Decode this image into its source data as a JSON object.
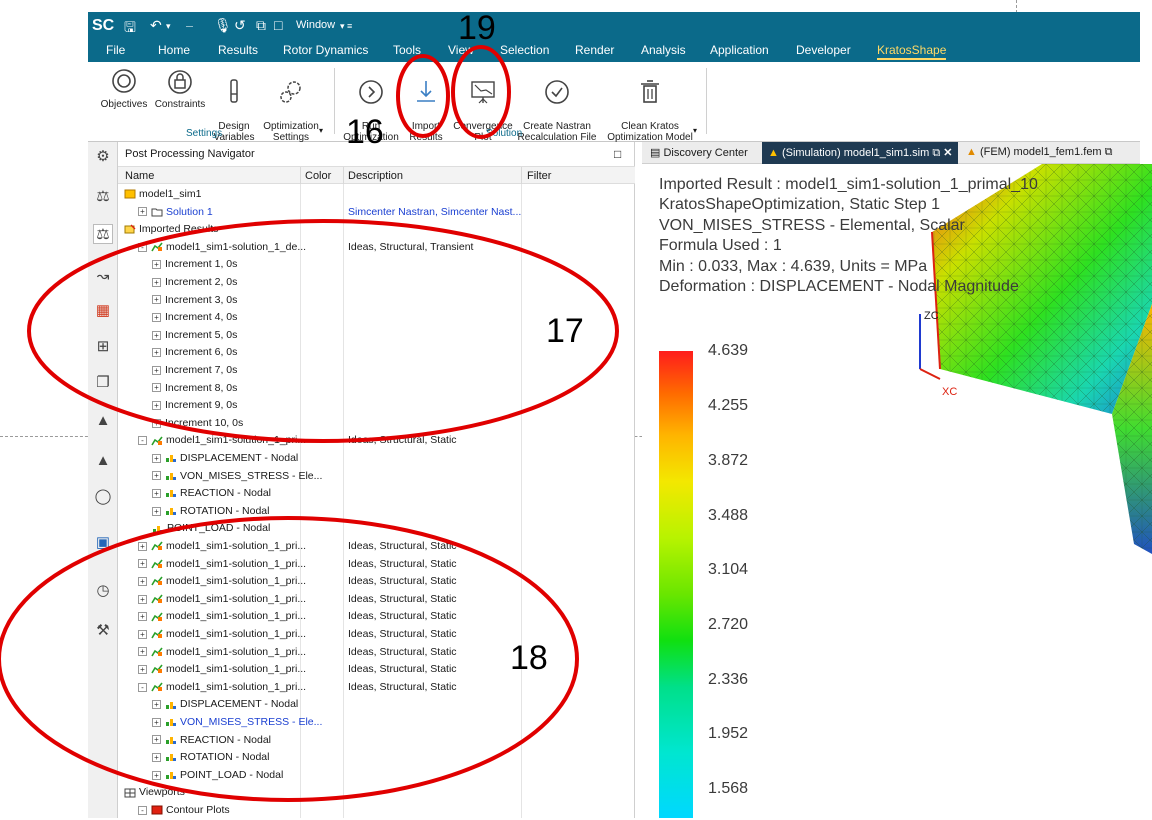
{
  "titlebar": {
    "logo": "SC",
    "window_label": "Window"
  },
  "menu": [
    "File",
    "Home",
    "Results",
    "Rotor Dynamics",
    "Tools",
    "View",
    "Selection",
    "Render",
    "Analysis",
    "Application",
    "Developer",
    "KratosShape"
  ],
  "ribbon": {
    "settings_buttons": [
      "Objectives",
      "Constraints",
      "Design\nVariables",
      "Optimization\nSettings"
    ],
    "settings_label": "Settings",
    "solution_buttons": [
      "Run\nOptimization",
      "Import\nResults",
      "Convergence\nPlot",
      "Create Nastran\nRecalculation File",
      "Clean Kratos\nOptimization Model"
    ],
    "solution_label": "Solution"
  },
  "navigator": {
    "title": "Post Processing Navigator",
    "columns": [
      "Name",
      "Color",
      "Description",
      "Filter"
    ],
    "rows": [
      {
        "name": "model1_sim1",
        "desc": "",
        "indent": 0,
        "exp": "",
        "icon": "sim"
      },
      {
        "name": "Solution 1",
        "desc": "Simcenter Nastran, Simcenter Nast...",
        "indent": 1,
        "exp": "+",
        "icon": "folder",
        "blue": true
      },
      {
        "name": "Imported Results",
        "desc": "",
        "indent": 0,
        "exp": "",
        "icon": "import"
      },
      {
        "name": "model1_sim1-solution_1_de...",
        "desc": "Ideas, Structural, Transient",
        "indent": 1,
        "exp": "-",
        "icon": "result"
      },
      {
        "name": "Increment 1, 0s",
        "desc": "",
        "indent": 2,
        "exp": "+",
        "icon": ""
      },
      {
        "name": "Increment 2, 0s",
        "desc": "",
        "indent": 2,
        "exp": "+",
        "icon": ""
      },
      {
        "name": "Increment 3, 0s",
        "desc": "",
        "indent": 2,
        "exp": "+",
        "icon": ""
      },
      {
        "name": "Increment 4, 0s",
        "desc": "",
        "indent": 2,
        "exp": "+",
        "icon": ""
      },
      {
        "name": "Increment 5, 0s",
        "desc": "",
        "indent": 2,
        "exp": "+",
        "icon": ""
      },
      {
        "name": "Increment 6, 0s",
        "desc": "",
        "indent": 2,
        "exp": "+",
        "icon": ""
      },
      {
        "name": "Increment 7, 0s",
        "desc": "",
        "indent": 2,
        "exp": "+",
        "icon": ""
      },
      {
        "name": "Increment 8, 0s",
        "desc": "",
        "indent": 2,
        "exp": "+",
        "icon": ""
      },
      {
        "name": "Increment 9, 0s",
        "desc": "",
        "indent": 2,
        "exp": "+",
        "icon": ""
      },
      {
        "name": "Increment 10, 0s",
        "desc": "",
        "indent": 2,
        "exp": "+",
        "icon": ""
      },
      {
        "name": "model1_sim1-solution_1_pri...",
        "desc": "Ideas, Structural, Static",
        "indent": 1,
        "exp": "-",
        "icon": "result"
      },
      {
        "name": "DISPLACEMENT - Nodal",
        "desc": "",
        "indent": 2,
        "exp": "+",
        "icon": "field"
      },
      {
        "name": "VON_MISES_STRESS - Ele...",
        "desc": "",
        "indent": 2,
        "exp": "+",
        "icon": "field"
      },
      {
        "name": "REACTION - Nodal",
        "desc": "",
        "indent": 2,
        "exp": "+",
        "icon": "field"
      },
      {
        "name": "ROTATION - Nodal",
        "desc": "",
        "indent": 2,
        "exp": "+",
        "icon": "field"
      },
      {
        "name": "POINT_LOAD - Nodal",
        "desc": "",
        "indent": 2,
        "exp": "",
        "icon": "field"
      },
      {
        "name": "model1_sim1-solution_1_pri...",
        "desc": "Ideas, Structural, Static",
        "indent": 1,
        "exp": "+",
        "icon": "result"
      },
      {
        "name": "model1_sim1-solution_1_pri...",
        "desc": "Ideas, Structural, Static",
        "indent": 1,
        "exp": "+",
        "icon": "result"
      },
      {
        "name": "model1_sim1-solution_1_pri...",
        "desc": "Ideas, Structural, Static",
        "indent": 1,
        "exp": "+",
        "icon": "result"
      },
      {
        "name": "model1_sim1-solution_1_pri...",
        "desc": "Ideas, Structural, Static",
        "indent": 1,
        "exp": "+",
        "icon": "result"
      },
      {
        "name": "model1_sim1-solution_1_pri...",
        "desc": "Ideas, Structural, Static",
        "indent": 1,
        "exp": "+",
        "icon": "result"
      },
      {
        "name": "model1_sim1-solution_1_pri...",
        "desc": "Ideas, Structural, Static",
        "indent": 1,
        "exp": "+",
        "icon": "result"
      },
      {
        "name": "model1_sim1-solution_1_pri...",
        "desc": "Ideas, Structural, Static",
        "indent": 1,
        "exp": "+",
        "icon": "result"
      },
      {
        "name": "model1_sim1-solution_1_pri...",
        "desc": "Ideas, Structural, Static",
        "indent": 1,
        "exp": "+",
        "icon": "result"
      },
      {
        "name": "model1_sim1-solution_1_pri...",
        "desc": "Ideas, Structural, Static",
        "indent": 1,
        "exp": "-",
        "icon": "result"
      },
      {
        "name": "DISPLACEMENT - Nodal",
        "desc": "",
        "indent": 2,
        "exp": "+",
        "icon": "field"
      },
      {
        "name": "VON_MISES_STRESS - Ele...",
        "desc": "",
        "indent": 2,
        "exp": "+",
        "icon": "field",
        "blue": true
      },
      {
        "name": "REACTION - Nodal",
        "desc": "",
        "indent": 2,
        "exp": "+",
        "icon": "field"
      },
      {
        "name": "ROTATION - Nodal",
        "desc": "",
        "indent": 2,
        "exp": "+",
        "icon": "field"
      },
      {
        "name": "POINT_LOAD - Nodal",
        "desc": "",
        "indent": 2,
        "exp": "+",
        "icon": "field"
      },
      {
        "name": "Viewports",
        "desc": "",
        "indent": 0,
        "exp": "",
        "icon": "viewport"
      },
      {
        "name": "Contour Plots",
        "desc": "",
        "indent": 1,
        "exp": "-",
        "icon": "contour"
      }
    ]
  },
  "tabs": [
    {
      "label": "Discovery Center",
      "active": false
    },
    {
      "label": "(Simulation) model1_sim1.sim",
      "active": true
    },
    {
      "label": "(FEM) model1_fem1.fem",
      "active": false
    }
  ],
  "viewer": {
    "info_lines": [
      "Imported Result : model1_sim1-solution_1_primal_10",
      "KratosShapeOptimization, Static Step 1",
      "VON_MISES_STRESS - Elemental, Scalar",
      "Formula Used : 1",
      "Min : 0.033, Max : 4.639, Units = MPa",
      "Deformation : DISPLACEMENT - Nodal Magnitude"
    ],
    "legend_values": [
      "4.639",
      "4.255",
      "3.872",
      "3.488",
      "3.104",
      "2.720",
      "2.336",
      "1.952",
      "1.568"
    ],
    "axis_z": "ZC",
    "axis_x": "XC"
  },
  "annotations": [
    "16",
    "17",
    "18",
    "19"
  ],
  "colors": {
    "ribbon_blue": "#0b6a8a",
    "annotation_red": "#e00000",
    "active_tab": "#1f3a52",
    "link_blue": "#1a3fd1"
  }
}
